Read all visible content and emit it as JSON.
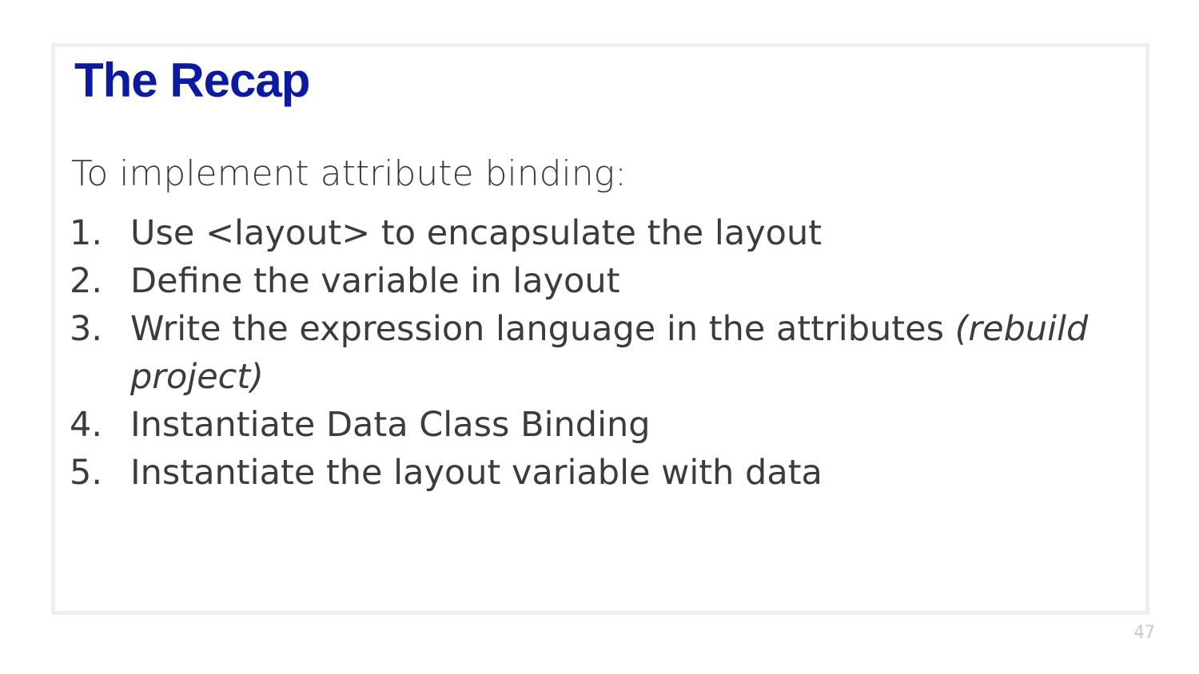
{
  "slide": {
    "title": "The Recap",
    "intro": "To implement attribute binding:",
    "steps": [
      {
        "number": "1.",
        "text": "Use <layout> to encapsulate the layout",
        "note": ""
      },
      {
        "number": "2.",
        "text": "Define the variable in layout",
        "note": ""
      },
      {
        "number": "3.",
        "text": "Write the expression language in the attributes ",
        "note": "(rebuild project)"
      },
      {
        "number": "4.",
        "text": "Instantiate Data Class Binding",
        "note": ""
      },
      {
        "number": "5.",
        "text": "Instantiate the layout variable with data",
        "note": ""
      }
    ],
    "page_number": "47"
  },
  "colors": {
    "title": "#0a1aa6",
    "body_text": "#3c3c3c",
    "frame_border": "#efefef",
    "page_number": "#c8c8c8"
  }
}
